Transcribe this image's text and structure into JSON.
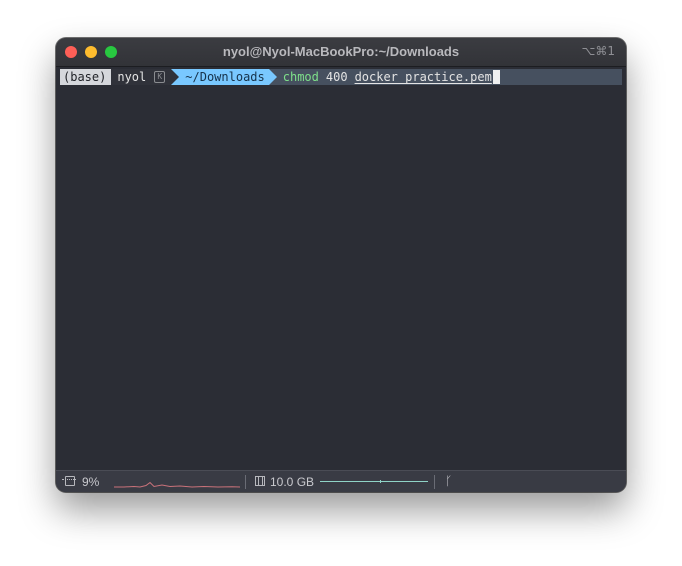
{
  "window": {
    "title": "nyol@Nyol-MacBookPro:~/Downloads",
    "shortcut": "⌥⌘1"
  },
  "prompt": {
    "env": "(base)",
    "user": "nyol",
    "user_badge": "K",
    "directory": "~/Downloads",
    "command": "chmod",
    "argument": "400",
    "file": "docker_practice.pem"
  },
  "statusbar": {
    "cpu_percent": "9%",
    "memory": "10.0 GB"
  },
  "colors": {
    "terminal_bg": "#2b2d35",
    "prompt_line_bg": "#46505f",
    "dir_segment": "#79c8ff",
    "command": "#7ee08a",
    "spark_line": "#c9727a",
    "memory_line": "#8fd3c7"
  },
  "icons": {
    "cpu": "cpu-icon",
    "memory": "memory-icon",
    "branch": "git-branch-icon"
  }
}
